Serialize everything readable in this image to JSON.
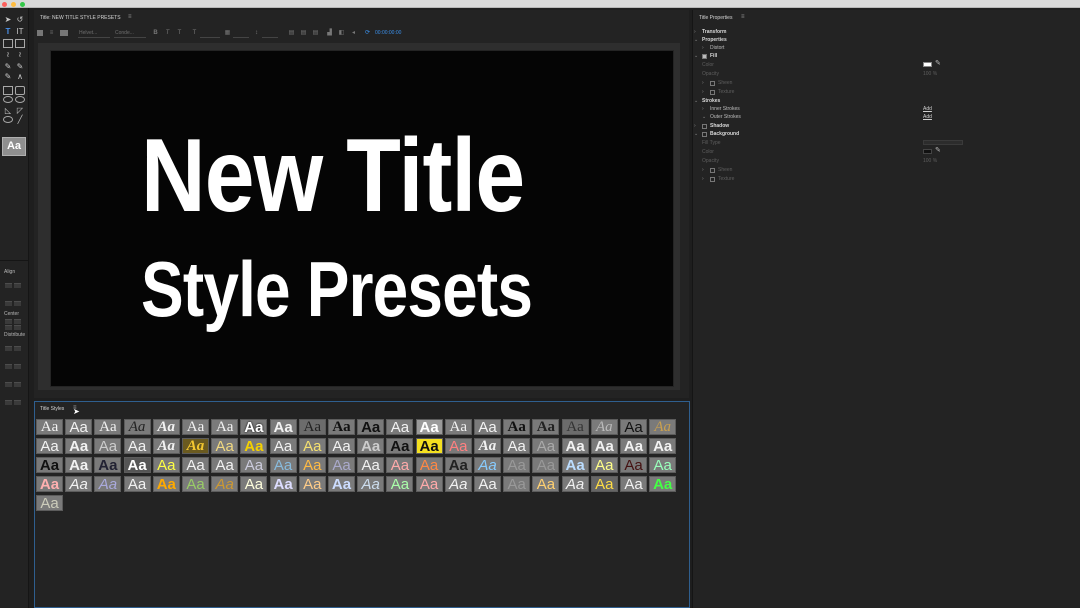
{
  "window": {
    "title_tab": "Title: NEW TITLE STYLE PRESETS",
    "menu_glyph": "≡"
  },
  "toolbar": {
    "font_family": "Helvet...",
    "font_style": "Conde...",
    "timecode": "00:00:00:00"
  },
  "canvas": {
    "line1": "New Title",
    "line2": "Style Presets"
  },
  "left_tools": {
    "align_label": "Align",
    "center_label": "Center",
    "distribute_label": "Distribute",
    "active_style": "Aa"
  },
  "title_styles": {
    "tab": "Title Styles",
    "menu_glyph": "≡",
    "swatch_label": "Aa",
    "rows": 5,
    "columns": 22,
    "count": 89
  },
  "title_properties": {
    "title": "Title Properties",
    "menu_glyph": "≡",
    "transform": "Transform",
    "properties": "Properties",
    "distort": "Distort",
    "fill": "Fill",
    "fill_color_label": "Color",
    "fill_opacity_label": "Opacity",
    "fill_opacity": "100 %",
    "sheen": "Sheen",
    "texture": "Texture",
    "strokes": "Strokes",
    "inner_strokes": "Inner Strokes",
    "outer_strokes": "Outer Strokes",
    "add": "Add",
    "shadow": "Shadow",
    "background": "Background",
    "fill_type": "Fill Type",
    "bg_color_label": "Color",
    "bg_opacity_label": "Opacity",
    "bg_opacity": "100 %",
    "bg_sheen": "Sheen",
    "bg_texture": "Texture"
  },
  "colors": {
    "accent": "#3b8fe8",
    "canvas_bg": "#050505",
    "panel_bg": "#232323",
    "swatch_bg": "#7a7a7a"
  }
}
